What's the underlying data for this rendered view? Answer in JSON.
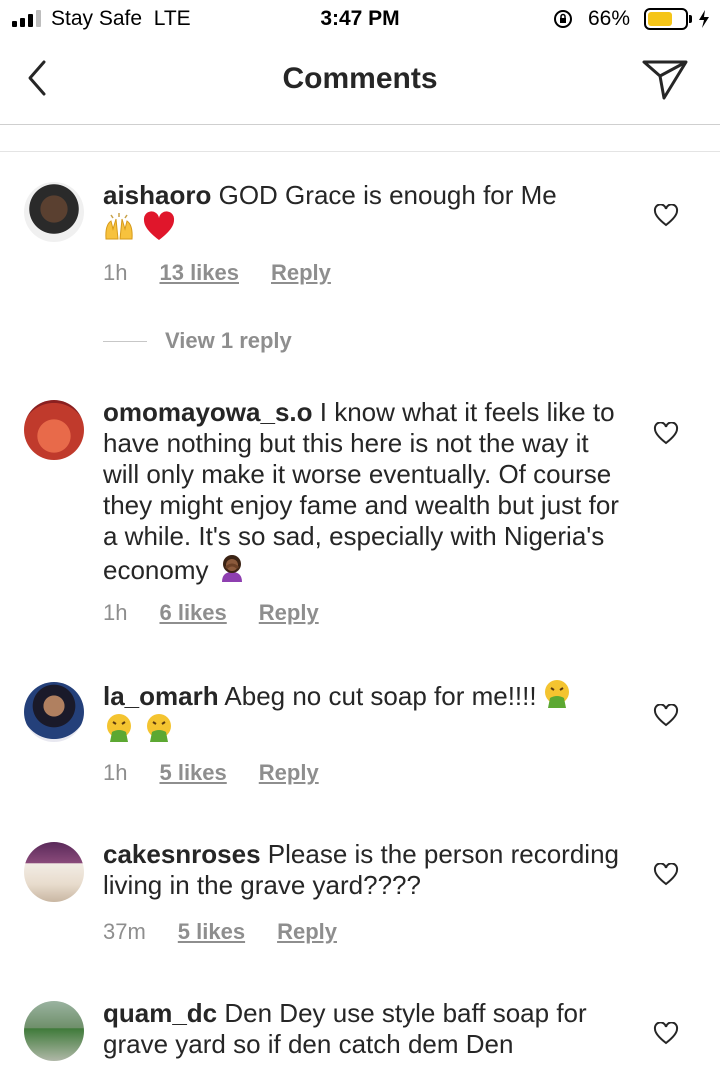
{
  "status_bar": {
    "carrier": "Stay Safe",
    "network": "LTE",
    "time": "3:47 PM",
    "battery_percent": "66%",
    "battery_level": 0.66,
    "signal_bars": 3
  },
  "header": {
    "title": "Comments"
  },
  "comments": [
    {
      "username": "aishaoro",
      "text": "GOD Grace is enough for Me",
      "emojis": [
        "raising-hands",
        "red-heart"
      ],
      "time": "1h",
      "likes": "13 likes",
      "reply": "Reply",
      "view_replies": "View 1 reply"
    },
    {
      "username": "omomayowa_s.o",
      "text": "I know what it feels like to have nothing but this here is not the way it will only make it worse eventually. Of course they might enjoy fame and wealth but just for a while. It's so sad, especially with Nigeria's economy",
      "emojis": [
        "person-facepalming"
      ],
      "time": "1h",
      "likes": "6 likes",
      "reply": "Reply"
    },
    {
      "username": "la_omarh",
      "text": "Abeg no cut soap for me!!!!",
      "emojis": [
        "vomiting-face",
        "vomiting-face",
        "vomiting-face"
      ],
      "time": "1h",
      "likes": "5 likes",
      "reply": "Reply"
    },
    {
      "username": "cakesnroses",
      "text": "Please is the person recording living in the grave yard????",
      "time": "37m",
      "likes": "5 likes",
      "reply": "Reply"
    },
    {
      "username": "quam_dc",
      "text": "Den Dey use style baff soap for grave yard so if den catch dem Den"
    }
  ]
}
